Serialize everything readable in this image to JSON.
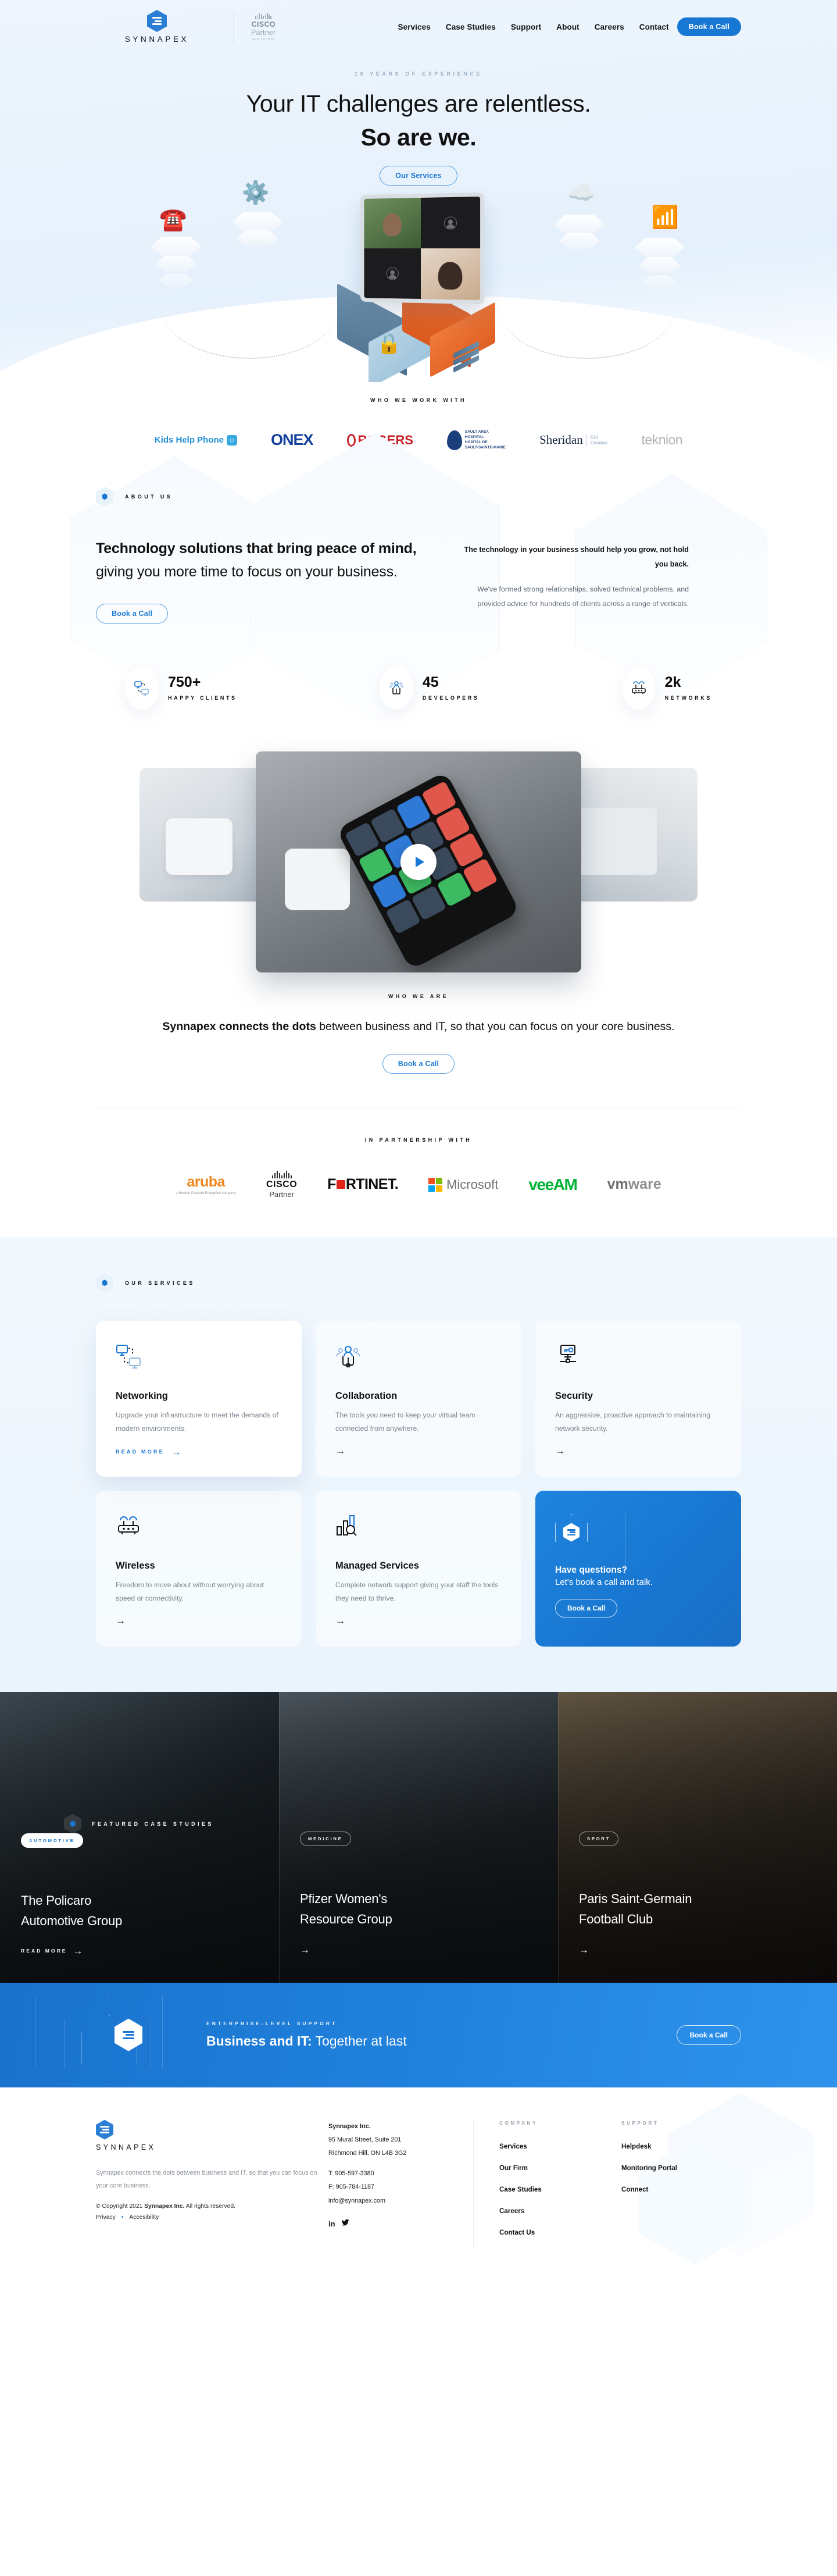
{
  "nav": {
    "brand_name": "SYNNAPEX",
    "cisco_line1": "CISCO",
    "cisco_line2": "Partner",
    "cisco_line3": "Gold Certified",
    "links": [
      {
        "label": "Services"
      },
      {
        "label": "Case Studies"
      },
      {
        "label": "Support"
      },
      {
        "label": "About"
      },
      {
        "label": "Careers"
      },
      {
        "label": "Contact"
      }
    ],
    "cta": "Book a Call"
  },
  "hero": {
    "eyebrow": "10 YEARS OF EXPERIENCE",
    "headline_line1": "Your IT challenges are relentless.",
    "headline_line2": "So are we.",
    "cta": "Our Services"
  },
  "clients": {
    "label": "WHO WE WORK WITH",
    "logos": [
      {
        "name": "Kids Help Phone"
      },
      {
        "name": "ONEX"
      },
      {
        "name": "ROGERS"
      },
      {
        "name": "Sault Area Hospital"
      },
      {
        "name": "Sheridan"
      },
      {
        "name": "teknion"
      }
    ],
    "sault_l1": "SAULT AREA",
    "sault_l2": "HOSPITAL",
    "sault_l3": "HÔPITAL DE",
    "sault_l4": "SAULT-SAINTE-MARIE",
    "sheridan_name": "Sheridan",
    "sheridan_sub1": "Get",
    "sheridan_sub2": "Creative",
    "teknion": "teknion",
    "kids": "Kids Help Phone",
    "onex": "ONEX",
    "rogers": "ROGERS"
  },
  "about": {
    "label": "ABOUT US",
    "heading_bold1": "Technology solutions that bring",
    "heading_bold2": "peace of mind,",
    "heading_rest1": " giving you more time",
    "heading_rest2": "to focus on your business.",
    "cta": "Book a Call",
    "lead": "The technology in your business should help you grow, not hold you back.",
    "body": "We've formed strong relationships, solved technical problems, and provided advice for hundreds of clients across a range of verticals."
  },
  "stats": [
    {
      "value": "750+",
      "label": "HAPPY CLIENTS",
      "icon": "network-screens-icon"
    },
    {
      "value": "45",
      "label": "DEVELOPERS",
      "icon": "people-group-icon"
    },
    {
      "value": "2k",
      "label": "NETWORKS",
      "icon": "router-icon"
    }
  ],
  "video": {
    "play_label": "Play video"
  },
  "whowe": {
    "label": "WHO WE ARE",
    "bold": "Synnapex connects the dots",
    "rest": " between business and IT, so that you can focus on your core business.",
    "cta": "Book a Call"
  },
  "partners": {
    "label": "IN PARTNERSHIP WITH",
    "aruba_name": "aruba",
    "aruba_sub": "a Hewlett Packard Enterprise company",
    "cisco_name": "CISCO",
    "cisco_sub": "Partner",
    "fortinet": "F RTINET.",
    "fortinet_pre": "F",
    "fortinet_post": "RTINET.",
    "microsoft": "Microsoft",
    "veeam": "veeAM",
    "vmware_bold": "vm",
    "vmware_rest": "ware"
  },
  "services": {
    "label": "OUR SERVICES",
    "cards": [
      {
        "title": "Networking",
        "desc": "Upgrade your infrastructure to meet the demands of modern environments.",
        "read_more": "READ MORE",
        "icon": "two-screens-network-icon",
        "active": true
      },
      {
        "title": "Collaboration",
        "desc": "The tools you need to keep your virtual team connected from anywhere.",
        "icon": "people-group-icon",
        "active": false
      },
      {
        "title": "Security",
        "desc": "An aggressive, proactive approach to maintaining network security.",
        "icon": "key-node-icon",
        "active": false
      },
      {
        "title": "Wireless",
        "desc": "Freedom to move about without worrying about speed or connectivity.",
        "icon": "router-icon",
        "active": false
      },
      {
        "title": "Managed Services",
        "desc": "Complete network support giving your staff the tools they need to thrive.",
        "icon": "bar-chart-search-icon",
        "active": false
      }
    ],
    "promo": {
      "title": "Have questions?",
      "subtitle": "Let's book a call and talk.",
      "cta": "Book a Call"
    }
  },
  "cases": {
    "label": "FEATURED CASE STUDIES",
    "items": [
      {
        "tag": "AUTOMOTIVE",
        "title_l1": "The Policaro",
        "title_l2": "Automotive Group",
        "link": "READ MORE"
      },
      {
        "tag": "MEDICINE",
        "title_l1": "Pfizer Women's",
        "title_l2": "Resource Group",
        "link": ""
      },
      {
        "tag": "SPORT",
        "title_l1": "Paris Saint-Germain",
        "title_l2": "Football Club",
        "link": ""
      }
    ]
  },
  "bigcta": {
    "label": "ENTERPRISE-LEVEL SUPPORT",
    "heading_bold": "Business and IT:",
    "heading_rest": " Together at last",
    "cta": "Book a Call"
  },
  "footer": {
    "brand_name": "SYNNAPEX",
    "desc": "Synnapex connects the dots between business and IT, so that you can focus on your core business.",
    "copyright_pre": "© Copyright 2021 ",
    "copyright_brand": "Synnapex Inc.",
    "copyright_post": " All rights reserved.",
    "privacy": "Privacy",
    "accessibility": "Accesibility",
    "company_name": "Synnapex Inc.",
    "address_l1": "95 Mural Street, Suite 201",
    "address_l2": "Richmond Hill, ON L4B 3G2",
    "phone": "T: 905-597-3380",
    "fax": "F: 905-784-1187",
    "email": "info@synnapex.com",
    "social": [
      {
        "name": "linkedin-icon",
        "glyph": "in"
      },
      {
        "name": "twitter-icon",
        "glyph": "🐦"
      }
    ],
    "columns": [
      {
        "heading": "COMPANY",
        "items": [
          {
            "label": "Services"
          },
          {
            "label": "Our Firm"
          },
          {
            "label": "Case Studies"
          },
          {
            "label": "Careers"
          },
          {
            "label": "Contact Us"
          }
        ]
      },
      {
        "heading": "SUPPORT",
        "items": [
          {
            "label": "Helpdesk"
          },
          {
            "label": "Monitoring Portal"
          },
          {
            "label": "Connect"
          }
        ]
      }
    ]
  },
  "colors": {
    "brand_blue": "#1877d2",
    "accent_orange": "#f0861d",
    "hero_bg": "#e8f2fc",
    "muted": "#7b858f"
  }
}
